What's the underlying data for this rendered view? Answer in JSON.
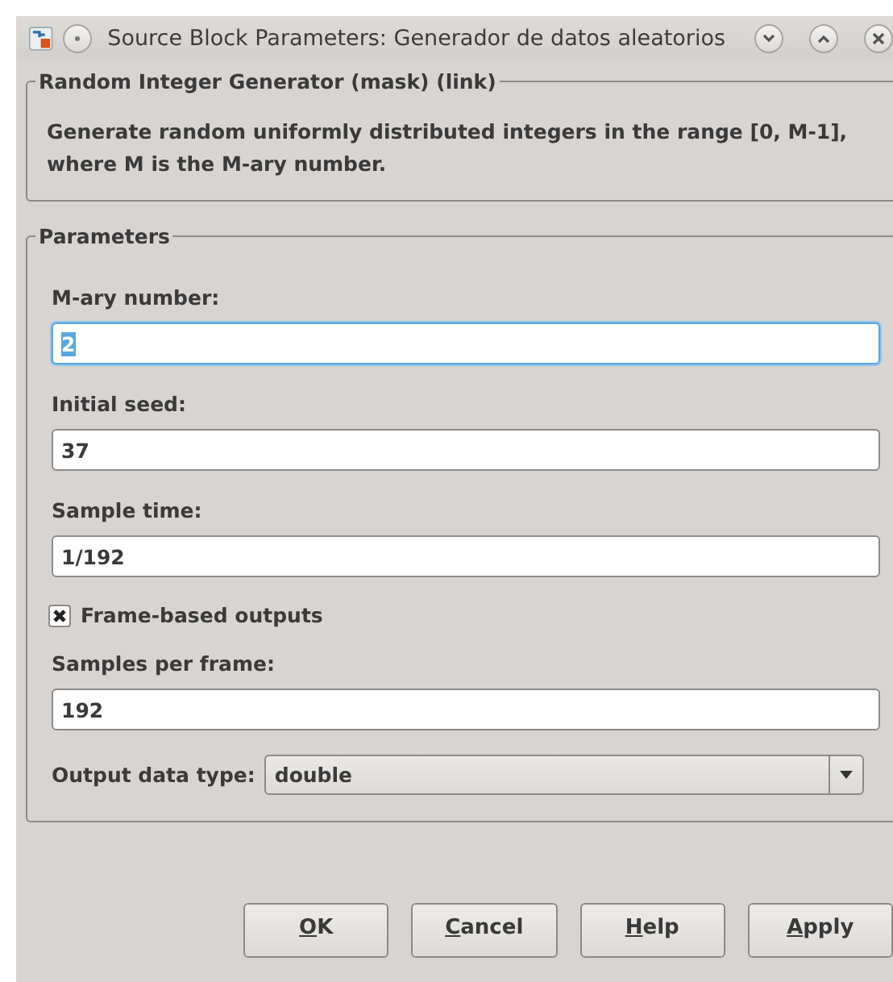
{
  "window": {
    "title": "Source Block Parameters: Generador de datos aleatorios"
  },
  "description_group": {
    "title": "Random Integer Generator (mask) (link)",
    "text": "Generate random uniformly distributed integers in the range [0, M-1], where M is the M-ary number."
  },
  "parameters": {
    "title": "Parameters",
    "items": [
      {
        "kind": "field",
        "label": "M-ary number:",
        "value": "2",
        "focused": true
      },
      {
        "kind": "field",
        "label": "Initial seed:",
        "value": "37",
        "focused": false
      },
      {
        "kind": "field",
        "label": "Sample time:",
        "value": "1/192",
        "focused": false
      },
      {
        "kind": "checkbox",
        "label": "Frame-based outputs",
        "checked": true
      },
      {
        "kind": "field",
        "label": "Samples per frame:",
        "value": "192",
        "focused": false
      },
      {
        "kind": "dropdown",
        "label": "Output data type:",
        "value": "double"
      }
    ]
  },
  "buttons": [
    "OK",
    "Cancel",
    "Help",
    "Apply"
  ]
}
